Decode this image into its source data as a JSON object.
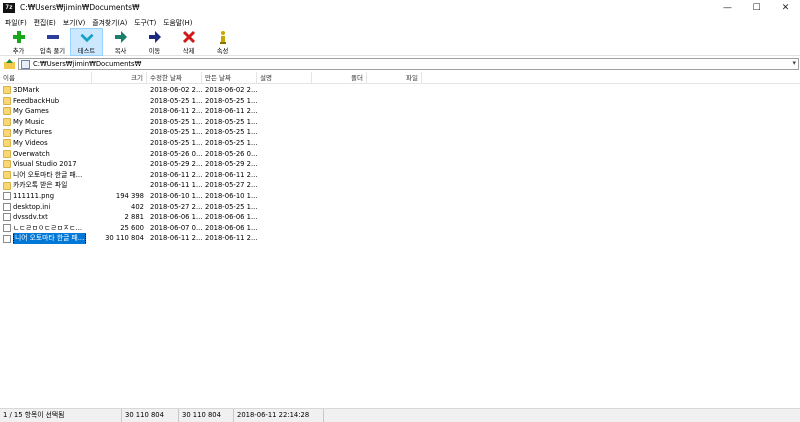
{
  "window": {
    "app_icon_text": "7z",
    "title": "C:₩Users₩jimin₩Documents₩",
    "buttons": {
      "minimize": "—",
      "maximize": "☐",
      "close": "✕"
    }
  },
  "menu": [
    {
      "label": "파일(F)"
    },
    {
      "label": "편집(E)"
    },
    {
      "label": "보기(V)"
    },
    {
      "label": "즐겨찾기(A)"
    },
    {
      "label": "도구(T)"
    },
    {
      "label": "도움말(H)"
    }
  ],
  "toolbar": [
    {
      "label": "추가",
      "icon": "plus-icon",
      "color": "#18a818"
    },
    {
      "label": "압축 풀기",
      "icon": "minus-icon",
      "color": "#2b3f9a"
    },
    {
      "label": "테스트",
      "icon": "check-chevron-icon",
      "color": "#1aa3c8"
    },
    {
      "label": "복사",
      "icon": "copy-arrow-icon",
      "color": "#1a7f6a"
    },
    {
      "label": "이동",
      "icon": "move-arrow-icon",
      "color": "#1a2a7f"
    },
    {
      "label": "삭제",
      "icon": "delete-x-icon",
      "color": "#d01818"
    },
    {
      "label": "속성",
      "icon": "info-icon",
      "color": "#c8a800"
    }
  ],
  "address": {
    "path": "C:₩Users₩jimin₩Documents₩"
  },
  "columns": {
    "name": "이름",
    "size": "크기",
    "modified": "수정한 날짜",
    "created": "만든 날짜",
    "comment": "설명",
    "folders": "폴더",
    "files": "파일"
  },
  "rows": [
    {
      "type": "folder",
      "name": "3DMark",
      "size": "",
      "modified": "2018-06-02 2...",
      "created": "2018-06-02 2..."
    },
    {
      "type": "folder",
      "name": "FeedbackHub",
      "size": "",
      "modified": "2018-05-25 1...",
      "created": "2018-05-25 1..."
    },
    {
      "type": "folder",
      "name": "My Games",
      "size": "",
      "modified": "2018-06-11 2...",
      "created": "2018-06-11 2..."
    },
    {
      "type": "folder",
      "name": "My Music",
      "size": "",
      "modified": "2018-05-25 1...",
      "created": "2018-05-25 1..."
    },
    {
      "type": "folder",
      "name": "My Pictures",
      "size": "",
      "modified": "2018-05-25 1...",
      "created": "2018-05-25 1..."
    },
    {
      "type": "folder",
      "name": "My Videos",
      "size": "",
      "modified": "2018-05-25 1...",
      "created": "2018-05-25 1..."
    },
    {
      "type": "folder",
      "name": "Overwatch",
      "size": "",
      "modified": "2018-05-26 0...",
      "created": "2018-05-26 0..."
    },
    {
      "type": "folder",
      "name": "Visual Studio 2017",
      "size": "",
      "modified": "2018-05-29 2...",
      "created": "2018-05-29 2..."
    },
    {
      "type": "folder",
      "name": "니어 오토마타 한글 패...",
      "size": "",
      "modified": "2018-06-11 2...",
      "created": "2018-06-11 2..."
    },
    {
      "type": "folder",
      "name": "카카오톡 받은 파일",
      "size": "",
      "modified": "2018-06-11 1...",
      "created": "2018-05-27 2..."
    },
    {
      "type": "file",
      "name": "111111.png",
      "size": "194 398",
      "modified": "2018-06-10 1...",
      "created": "2018-06-10 1..."
    },
    {
      "type": "file",
      "name": "desktop.ini",
      "size": "402",
      "modified": "2018-05-27 2...",
      "created": "2018-05-25 1..."
    },
    {
      "type": "file",
      "name": "dvssdv.txt",
      "size": "2 881",
      "modified": "2018-06-06 1...",
      "created": "2018-06-06 1..."
    },
    {
      "type": "file",
      "name": "ㄴㄷㄹㅁㅇㄷㄹㅁㅈㄷ...",
      "size": "25 600",
      "modified": "2018-06-07 0...",
      "created": "2018-06-06 1..."
    },
    {
      "type": "file",
      "name": "니어 오토마타 한글 패...",
      "size": "30 110 804",
      "modified": "2018-06-11 2...",
      "created": "2018-06-11 2...",
      "selected": true
    }
  ],
  "status": {
    "selection": "1 / 15 항목이 선택됨",
    "size": "30 110 804",
    "packed": "30 110 804",
    "modified": "2018-06-11 22:14:28"
  }
}
